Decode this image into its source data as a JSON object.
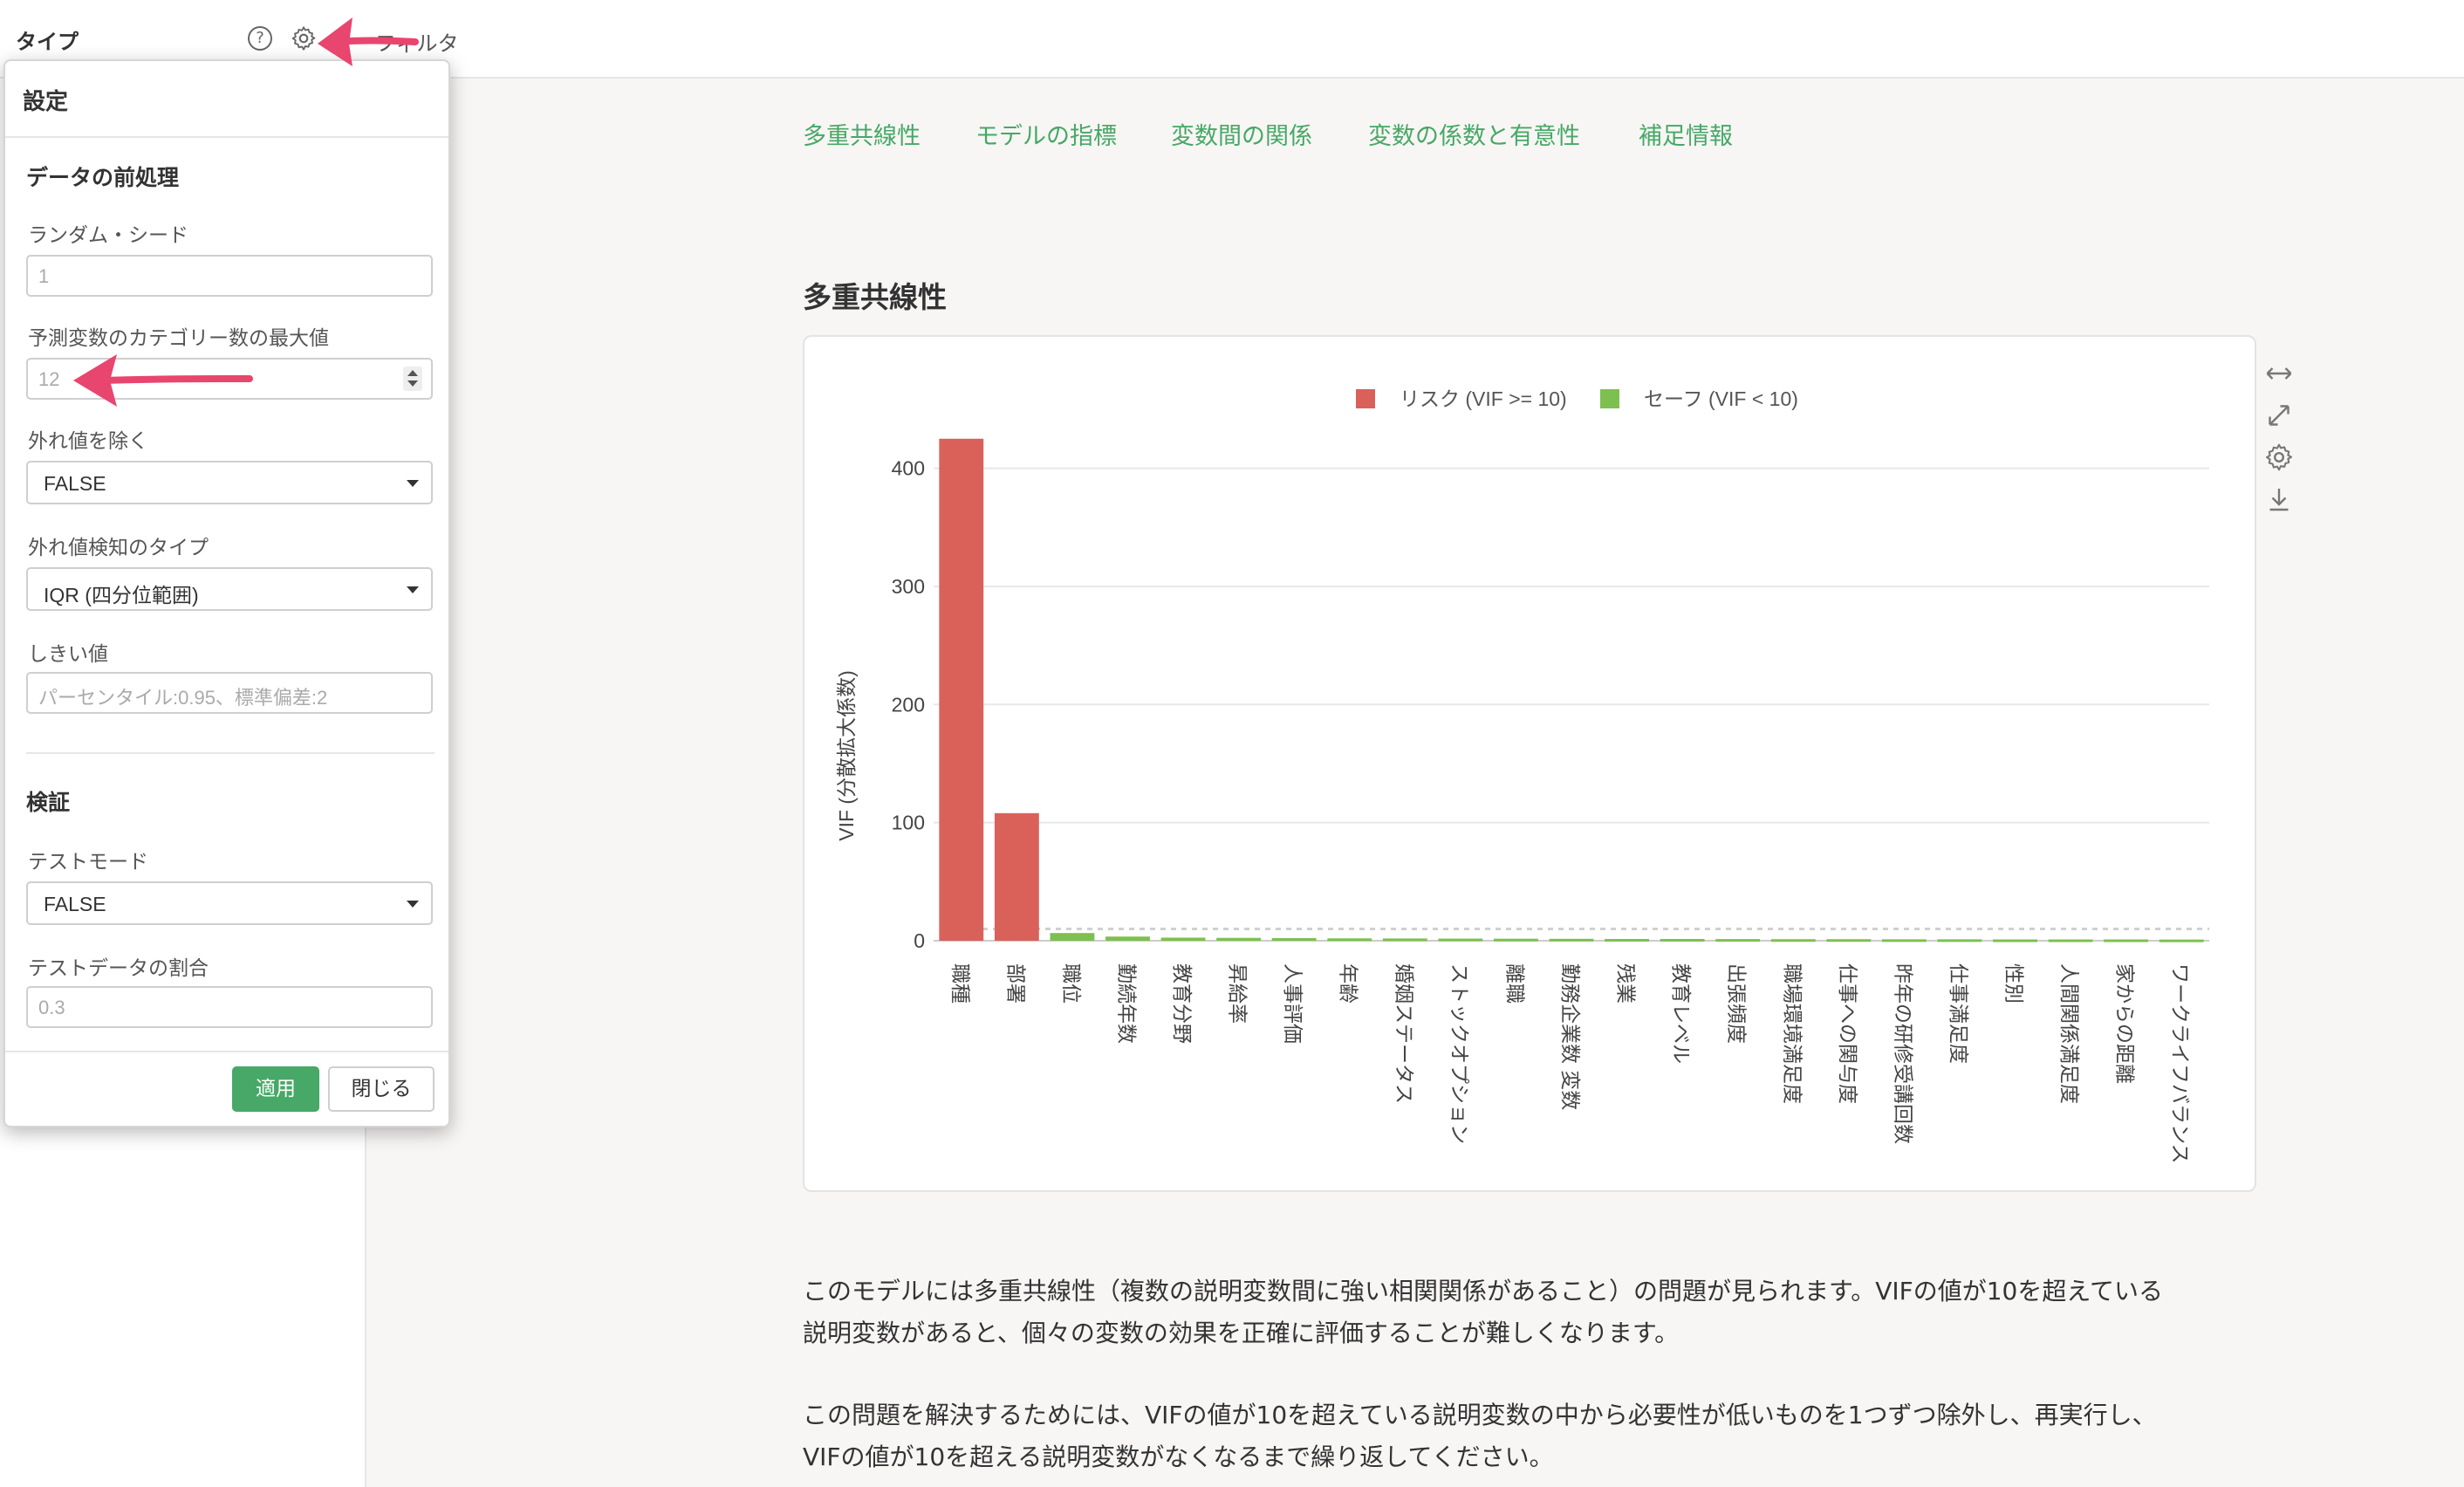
{
  "topbar": {
    "title": "タイプ",
    "help_icon": "?",
    "filter_label": "フィルタ"
  },
  "settings": {
    "title": "設定",
    "preprocess_title": "データの前処理",
    "random_seed_label": "ランダム・シード",
    "random_seed_placeholder": "1",
    "max_categories_label": "予測変数のカテゴリー数の最大値",
    "max_categories_placeholder": "12",
    "outlier_remove_label": "外れ値を除く",
    "outlier_remove_value": "FALSE",
    "outlier_type_label": "外れ値検知のタイプ",
    "outlier_type_value": "IQR (四分位範囲)",
    "threshold_label": "しきい値",
    "threshold_placeholder": "パーセンタイル:0.95、標準偏差:2",
    "validation_title": "検証",
    "test_mode_label": "テストモード",
    "test_mode_value": "FALSE",
    "test_ratio_label": "テストデータの割合",
    "test_ratio_placeholder": "0.3",
    "apply_label": "適用",
    "close_label": "閉じる"
  },
  "tabs": [
    "多重共線性",
    "モデルの指標",
    "変数間の関係",
    "変数の係数と有意性",
    "補足情報"
  ],
  "section_title": "多重共線性",
  "chart_tools": [
    "expand-horizontal-icon",
    "fullscreen-icon",
    "gear-icon",
    "download-icon"
  ],
  "description": {
    "p1_line1": "このモデルには多重共線性（複数の説明変数間に強い相関関係があること）の問題が見られます。VIFの値が10を超えている",
    "p1_line2": "説明変数があると、個々の変数の効果を正確に評価することが難しくなります。",
    "p2_line1": "この問題を解決するためには、VIFの値が10を超えている説明変数の中から必要性が低いものを1つずつ除外し、再実行し、",
    "p2_line2": "VIFの値が10を超える説明変数がなくなるまで繰り返してください。"
  },
  "colors": {
    "risk": "#d9615a",
    "safe": "#7dc04f",
    "accent": "#47a867",
    "annotation_arrow": "#e8456f"
  },
  "chart_data": {
    "type": "bar",
    "title": "",
    "xlabel": "",
    "ylabel": "VIF (分散拡大係数)",
    "ylim": [
      0,
      430
    ],
    "yticks": [
      0,
      100,
      200,
      300,
      400
    ],
    "threshold": 10,
    "grid": true,
    "legend_position": "top-center",
    "categories": [
      "職種",
      "部署",
      "職位",
      "勤続年数",
      "教育分野",
      "昇給率",
      "人事評価",
      "年齢",
      "婚姻ステータス",
      "ストックオプション",
      "離職",
      "勤務企業数 変数",
      "残業",
      "教育レベル",
      "出張頻度",
      "職場環境満足度",
      "仕事への関与度",
      "昨年の研修受講回数",
      "仕事満足度",
      "性別",
      "人間関係満足度",
      "家からの距離",
      "ワークライフバランス"
    ],
    "values": [
      425,
      108,
      6.5,
      3.5,
      2.6,
      2.4,
      2.2,
      2.0,
      1.9,
      1.8,
      1.7,
      1.6,
      1.5,
      1.5,
      1.4,
      1.3,
      1.3,
      1.2,
      1.2,
      1.1,
      1.1,
      1.1,
      1.0
    ],
    "series": [
      {
        "name": "リスク (VIF >= 10)",
        "color": "#d9615a"
      },
      {
        "name": "セーフ (VIF < 10)",
        "color": "#7dc04f"
      }
    ]
  }
}
